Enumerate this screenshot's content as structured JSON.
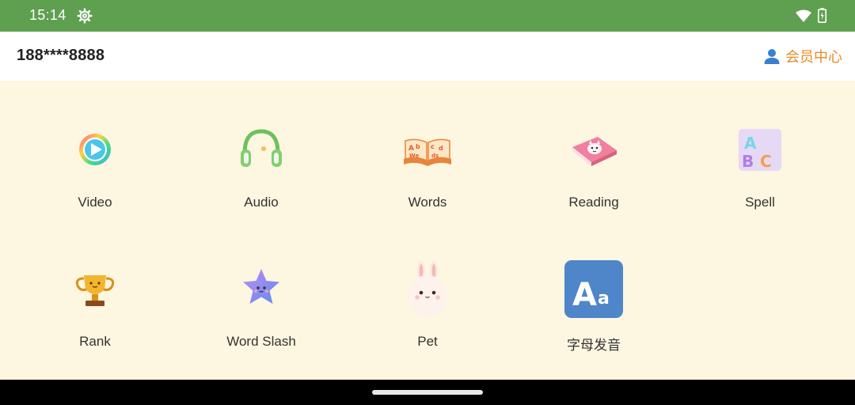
{
  "status_bar": {
    "time": "15:14",
    "icons": [
      "settings-gear-icon",
      "wifi-icon",
      "battery-icon"
    ],
    "color": "#5ea04f"
  },
  "header": {
    "phone": "188****8888",
    "member_center": "会员中心",
    "member_icon": "user-icon",
    "accent_color": "#e98b24"
  },
  "grid": {
    "background": "#fdf6e0",
    "items": [
      {
        "label": "Video",
        "icon": "video-play-icon"
      },
      {
        "label": "Audio",
        "icon": "headphones-icon"
      },
      {
        "label": "Words",
        "icon": "word-book-icon"
      },
      {
        "label": "Reading",
        "icon": "storybook-icon"
      },
      {
        "label": "Spell",
        "icon": "abc-blocks-icon"
      },
      {
        "label": "Rank",
        "icon": "trophy-icon"
      },
      {
        "label": "Word Slash",
        "icon": "star-icon"
      },
      {
        "label": "Pet",
        "icon": "bunny-icon"
      },
      {
        "label": "字母发音",
        "icon": "letter-aa-icon"
      }
    ]
  }
}
